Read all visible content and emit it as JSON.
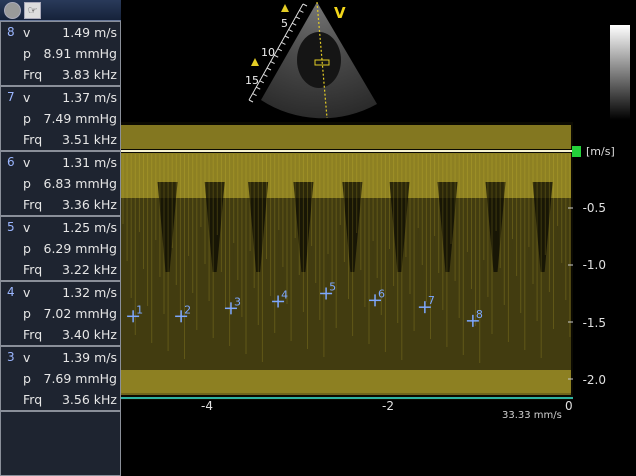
{
  "toolbar": {
    "circle_icon": "record-icon",
    "hand_icon": "pointer-icon",
    "hand_glyph": "☞"
  },
  "measurements": [
    {
      "num": "8",
      "v_label": "v",
      "v": "1.49 m/s",
      "p_label": "p",
      "p": "8.91 mmHg",
      "f_label": "Frq",
      "f": "3.83 kHz"
    },
    {
      "num": "7",
      "v_label": "v",
      "v": "1.37 m/s",
      "p_label": "p",
      "p": "7.49 mmHg",
      "f_label": "Frq",
      "f": "3.51 kHz"
    },
    {
      "num": "6",
      "v_label": "v",
      "v": "1.31 m/s",
      "p_label": "p",
      "p": "6.83 mmHg",
      "f_label": "Frq",
      "f": "3.36 kHz"
    },
    {
      "num": "5",
      "v_label": "v",
      "v": "1.25 m/s",
      "p_label": "p",
      "p": "6.29 mmHg",
      "f_label": "Frq",
      "f": "3.22 kHz"
    },
    {
      "num": "4",
      "v_label": "v",
      "v": "1.32 m/s",
      "p_label": "p",
      "p": "7.02 mmHg",
      "f_label": "Frq",
      "f": "3.40 kHz"
    },
    {
      "num": "3",
      "v_label": "v",
      "v": "1.39 m/s",
      "p_label": "p",
      "p": "7.69 mmHg",
      "f_label": "Frq",
      "f": "3.56 kHz"
    }
  ],
  "sector": {
    "mode_label": "V",
    "depth_marks": [
      "5",
      "10",
      "15"
    ]
  },
  "doppler": {
    "unit": "[m/s]",
    "y_ticks": [
      "-0.5",
      "-1.0",
      "-1.5",
      "-2.0"
    ],
    "x_ticks": [
      "-4",
      "-2",
      "0"
    ],
    "sweep_speed": "33.33 mm/s",
    "markers": [
      {
        "label": "1",
        "time": -4.8,
        "velocity": -1.45
      },
      {
        "label": "2",
        "time": -4.27,
        "velocity": -1.45
      },
      {
        "label": "3",
        "time": -3.72,
        "velocity": -1.38
      },
      {
        "label": "4",
        "time": -3.2,
        "velocity": -1.32
      },
      {
        "label": "5",
        "time": -2.67,
        "velocity": -1.25
      },
      {
        "label": "6",
        "time": -2.13,
        "velocity": -1.31
      },
      {
        "label": "7",
        "time": -1.58,
        "velocity": -1.37
      },
      {
        "label": "8",
        "time": -1.05,
        "velocity": -1.49
      }
    ],
    "colors": {
      "signal": "#e8d23a",
      "marker": "#7ea8ff",
      "baseline": "#2fb3a0"
    }
  }
}
